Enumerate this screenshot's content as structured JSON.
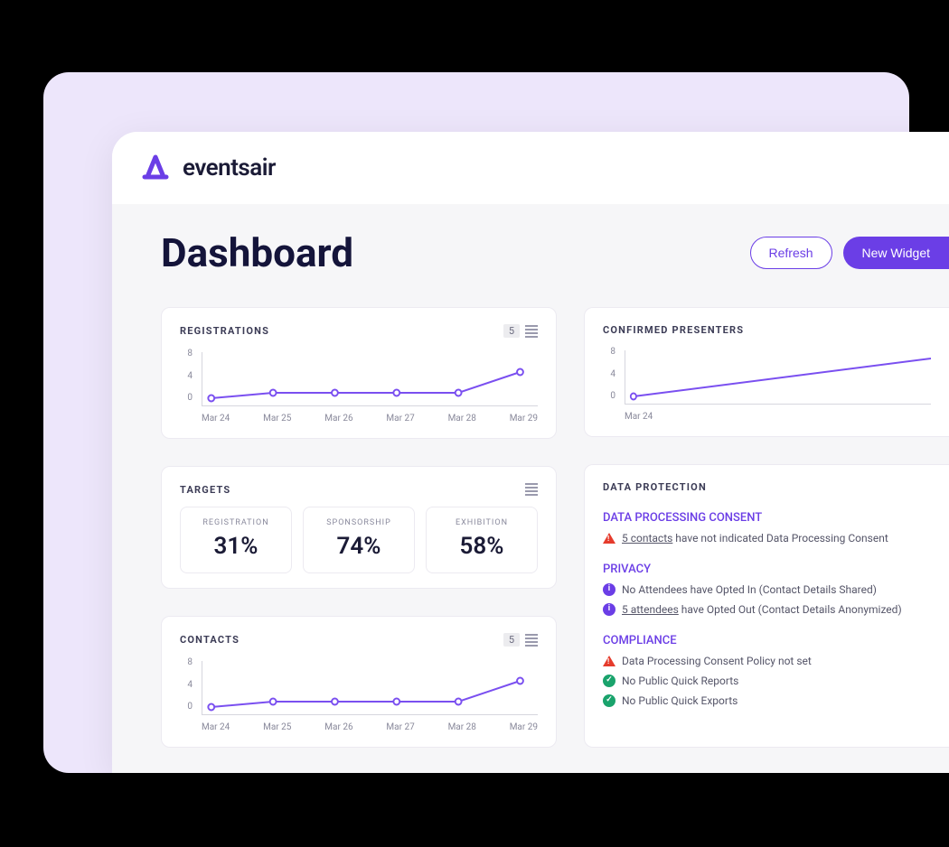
{
  "brand": {
    "name": "eventsair"
  },
  "page": {
    "title": "Dashboard",
    "actions": {
      "refresh": "Refresh",
      "new_widget": "New Widget"
    }
  },
  "widgets": {
    "registrations": {
      "title": "REGISTRATIONS",
      "count": "5"
    },
    "presenters": {
      "title": "CONFIRMED PRESENTERS"
    },
    "targets": {
      "title": "TARGETS",
      "items": [
        {
          "label": "REGISTRATION",
          "value": "31%"
        },
        {
          "label": "SPONSORSHIP",
          "value": "74%"
        },
        {
          "label": "EXHIBITION",
          "value": "58%"
        }
      ]
    },
    "contacts": {
      "title": "CONTACTS",
      "count": "5"
    },
    "data_protection": {
      "title": "DATA PROTECTION",
      "sections": {
        "consent": {
          "head": "DATA PROCESSING CONSENT",
          "line1_link": "5 contacts",
          "line1_rest": " have not indicated Data Processing Consent"
        },
        "privacy": {
          "head": "PRIVACY",
          "line1": "No Attendees have Opted In (Contact Details Shared)",
          "line2_link": "5 attendees",
          "line2_rest": " have Opted Out (Contact Details Anonymized)"
        },
        "compliance": {
          "head": "COMPLIANCE",
          "line1": "Data Processing Consent Policy not set",
          "line2": "No Public Quick Reports",
          "line3": "No Public Quick Exports"
        }
      }
    }
  },
  "chart_data": [
    {
      "id": "registrations",
      "type": "line",
      "categories": [
        "Mar 24",
        "Mar 25",
        "Mar 26",
        "Mar 27",
        "Mar 28",
        "Mar 29"
      ],
      "values": [
        1.2,
        2,
        2,
        2,
        2,
        5
      ],
      "y_ticks": [
        0,
        4,
        8
      ],
      "ylim": [
        0,
        8
      ]
    },
    {
      "id": "presenters",
      "type": "line",
      "categories": [
        "Mar 24"
      ],
      "values_partial": [
        1.2,
        6.8
      ],
      "y_ticks": [
        0,
        4,
        8
      ],
      "ylim": [
        0,
        8
      ]
    },
    {
      "id": "contacts",
      "type": "line",
      "categories": [
        "Mar 24",
        "Mar 25",
        "Mar 26",
        "Mar 27",
        "Mar 28",
        "Mar 29"
      ],
      "values": [
        1.2,
        2,
        2,
        2,
        2,
        5
      ],
      "y_ticks": [
        0,
        4,
        8
      ],
      "ylim": [
        0,
        8
      ]
    }
  ]
}
